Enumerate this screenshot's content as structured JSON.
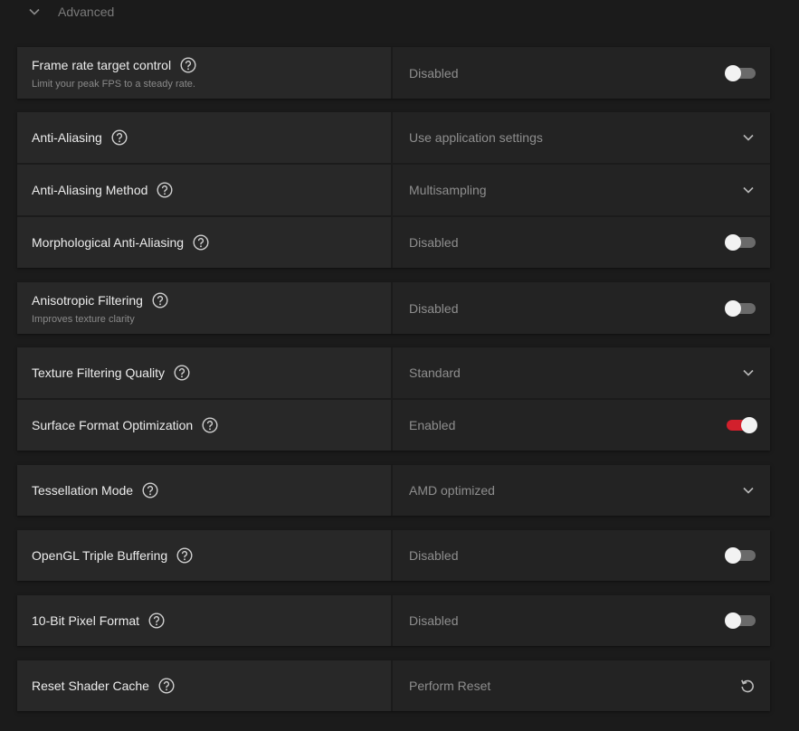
{
  "section": {
    "title": "Advanced"
  },
  "help_icon": "question-circle-icon",
  "accent_color": "#d2202c",
  "settings": [
    {
      "label": "Frame rate target control",
      "description": "Limit your peak FPS to a steady rate.",
      "value": "Disabled",
      "control": "toggle",
      "on": false
    },
    {
      "label": "Anti-Aliasing",
      "value": "Use application settings",
      "control": "dropdown"
    },
    {
      "label": "Anti-Aliasing Method",
      "value": "Multisampling",
      "control": "dropdown"
    },
    {
      "label": "Morphological Anti-Aliasing",
      "value": "Disabled",
      "control": "toggle",
      "on": false
    },
    {
      "label": "Anisotropic Filtering",
      "description": "Improves texture clarity",
      "value": "Disabled",
      "control": "toggle",
      "on": false
    },
    {
      "label": "Texture Filtering Quality",
      "value": "Standard",
      "control": "dropdown"
    },
    {
      "label": "Surface Format Optimization",
      "value": "Enabled",
      "control": "toggle",
      "on": true
    },
    {
      "label": "Tessellation Mode",
      "value": "AMD optimized",
      "control": "dropdown"
    },
    {
      "label": "OpenGL Triple Buffering",
      "value": "Disabled",
      "control": "toggle",
      "on": false
    },
    {
      "label": "10-Bit Pixel Format",
      "value": "Disabled",
      "control": "toggle",
      "on": false
    },
    {
      "label": "Reset Shader Cache",
      "value": "Perform Reset",
      "control": "reset"
    }
  ]
}
